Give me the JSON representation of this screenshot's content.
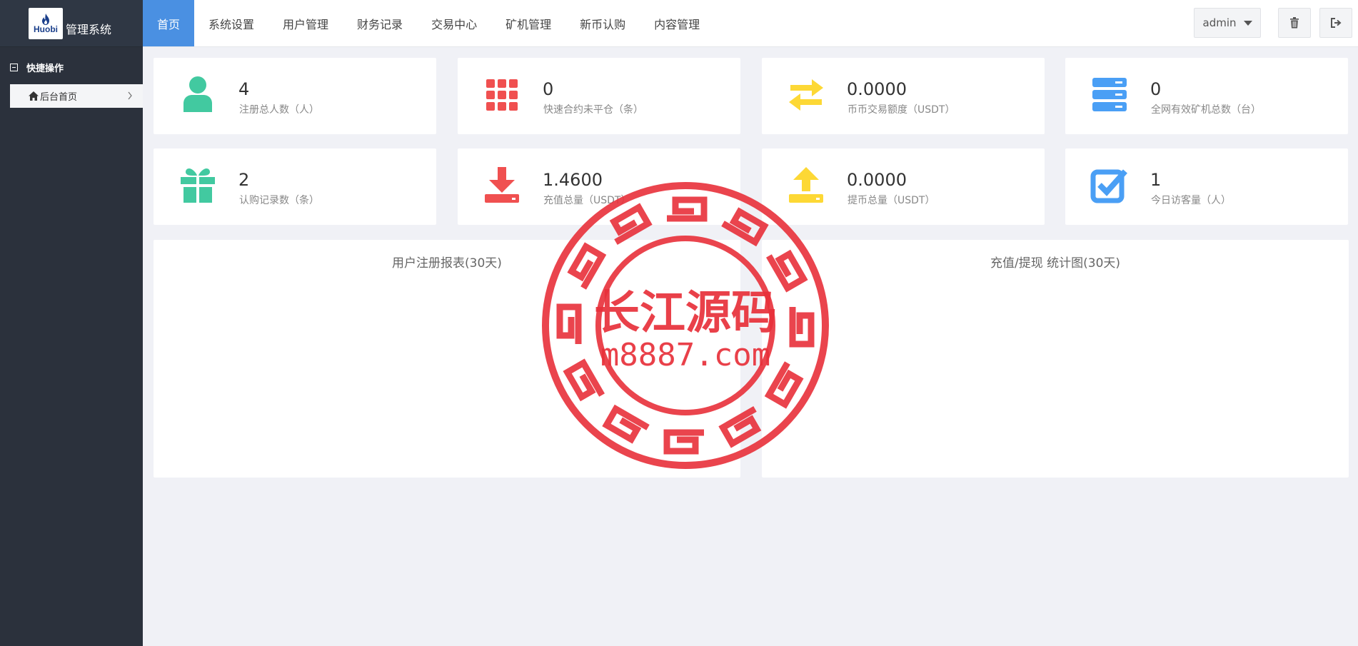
{
  "brand": {
    "logo_text": "Huobi",
    "title": "管理系统"
  },
  "sidebar": {
    "section_title": "快捷操作",
    "items": [
      {
        "label": "后台首页"
      }
    ]
  },
  "nav": {
    "items": [
      {
        "label": "首页",
        "active": true
      },
      {
        "label": "系统设置"
      },
      {
        "label": "用户管理"
      },
      {
        "label": "财务记录"
      },
      {
        "label": "交易中心"
      },
      {
        "label": "矿机管理"
      },
      {
        "label": "新币认购"
      },
      {
        "label": "内容管理"
      }
    ]
  },
  "topbar": {
    "user_label": "admin",
    "clear_cache_icon": "trash-icon",
    "logout_icon": "logout-icon"
  },
  "stats": [
    {
      "value": "4",
      "label": "注册总人数（人）",
      "icon": "user-icon",
      "color": "#42c9a0"
    },
    {
      "value": "0",
      "label": "快速合约未平仓（条）",
      "icon": "grid-icon",
      "color": "#f05050"
    },
    {
      "value": "0.0000",
      "label": "币币交易额度（USDT）",
      "icon": "exchange-icon",
      "color": "#fdd835"
    },
    {
      "value": "0",
      "label": "全网有效矿机总数（台）",
      "icon": "server-icon",
      "color": "#4a9ff5"
    },
    {
      "value": "2",
      "label": "认购记录数（条）",
      "icon": "gift-icon",
      "color": "#42c9a0"
    },
    {
      "value": "1.4600",
      "label": "充值总量（USDT）",
      "icon": "download-icon",
      "color": "#f05050"
    },
    {
      "value": "0.0000",
      "label": "提币总量（USDT）",
      "icon": "upload-icon",
      "color": "#fdd835"
    },
    {
      "value": "1",
      "label": "今日访客量（人）",
      "icon": "checkbox-icon",
      "color": "#4a9ff5"
    }
  ],
  "panels": {
    "registration_title": "用户注册报表(30天)",
    "finance_title": "充值/提现 统计图(30天)"
  },
  "watermark": {
    "line1": "长江源码",
    "line2": "m8887.com",
    "color": "#e8303a"
  }
}
